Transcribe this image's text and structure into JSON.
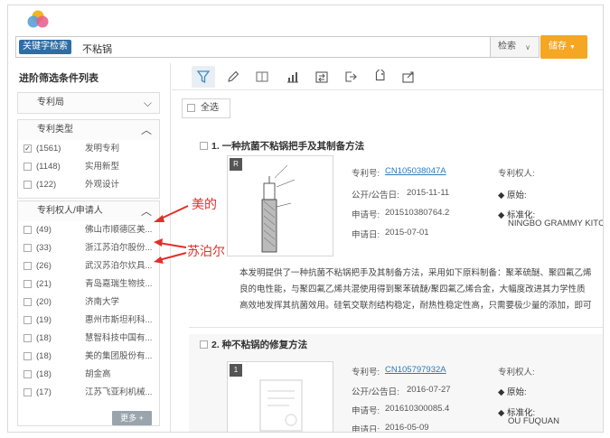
{
  "search": {
    "keyword_tag": "关键字检索",
    "query": "不粘锅",
    "search_button": "检索",
    "save_button": "储存"
  },
  "sidebar": {
    "title": "进阶筛选条件列表",
    "panels": [
      {
        "title": "专利局",
        "expanded": false,
        "options": []
      },
      {
        "title": "专利类型",
        "expanded": true,
        "options": [
          {
            "count": "(1561)",
            "label": "发明专利",
            "checked": true
          },
          {
            "count": "(1148)",
            "label": "实用新型",
            "checked": false
          },
          {
            "count": "(122)",
            "label": "外观设计",
            "checked": false
          }
        ]
      },
      {
        "title": "专利权人/申请人",
        "expanded": true,
        "options": [
          {
            "count": "(49)",
            "label": "佛山市顺德区美...",
            "checked": false
          },
          {
            "count": "(33)",
            "label": "浙江苏泊尔股份...",
            "checked": false
          },
          {
            "count": "(26)",
            "label": "武汉苏泊尔炊具...",
            "checked": false
          },
          {
            "count": "(21)",
            "label": "青岛嘉瑞生物技...",
            "checked": false
          },
          {
            "count": "(20)",
            "label": "济南大学",
            "checked": false
          },
          {
            "count": "(19)",
            "label": "惠州市斯坦利科...",
            "checked": false
          },
          {
            "count": "(18)",
            "label": "慧智科技中国有...",
            "checked": false
          },
          {
            "count": "(18)",
            "label": "美的集团股份有...",
            "checked": false
          },
          {
            "count": "(18)",
            "label": "胡金高",
            "checked": false
          },
          {
            "count": "(17)",
            "label": "江苏飞亚利机械...",
            "checked": false
          }
        ],
        "more_label": "更多 +"
      }
    ]
  },
  "toolbar": {
    "icons": [
      "filter-icon",
      "pen-icon",
      "book-icon",
      "chart-icon",
      "compare-icon",
      "export-icon",
      "tag-icon",
      "share-icon"
    ]
  },
  "main": {
    "select_all": "全选",
    "results": [
      {
        "title": "1. 一种抗菌不粘锅把手及其制备方法",
        "thumb_tag": "R",
        "patent_no_label": "专利号:",
        "patent_no": "CN105038047A",
        "pub_date_label": "公开/公告日:",
        "pub_date": "2015-11-11",
        "app_no_label": "申请号:",
        "app_no": "201510380764.2",
        "app_date_label": "申请日:",
        "app_date": "2015-07-01",
        "assignee_label": "专利权人:",
        "original_label": "◆ 原始:",
        "standard_label": "◆ 标准化:",
        "standard_value": "NINGBO GRAMMY KITCH",
        "abstract_lines": [
          "本发明提供了一种抗菌不粘锅把手及其制备方法，采用如下原料制备：聚苯硫醚、聚四氟乙烯",
          "良的电性能，与聚四氟乙烯共混使用得到聚苯硫醚/聚四氟乙烯合金，大幅度改进其力学性质",
          "高效地发挥其抗菌效用。硅氧交联剂结构稳定，耐热性稳定性高，只需要极少量的添加，即可"
        ]
      },
      {
        "title": "2. 种不粘锅的修复方法",
        "thumb_tag": "1",
        "patent_no_label": "专利号:",
        "patent_no": "CN105797932A",
        "pub_date_label": "公开/公告日:",
        "pub_date": "2016-07-27",
        "app_no_label": "申请号:",
        "app_no": "201610300085.4",
        "app_date_label": "申请日:",
        "app_date": "2016-05-09",
        "assignee_label": "专利权人:",
        "original_label": "◆ 原始:",
        "standard_label": "◆ 标准化:",
        "standard_value": "OU FUQUAN"
      }
    ]
  },
  "annotations": {
    "meidi": "美的",
    "supor": "苏泊尔"
  },
  "colors": {
    "accent_blue": "#2e6da4",
    "save_orange": "#f5a623",
    "annotation_red": "#e0302b",
    "link_blue": "#2b7bb9"
  }
}
